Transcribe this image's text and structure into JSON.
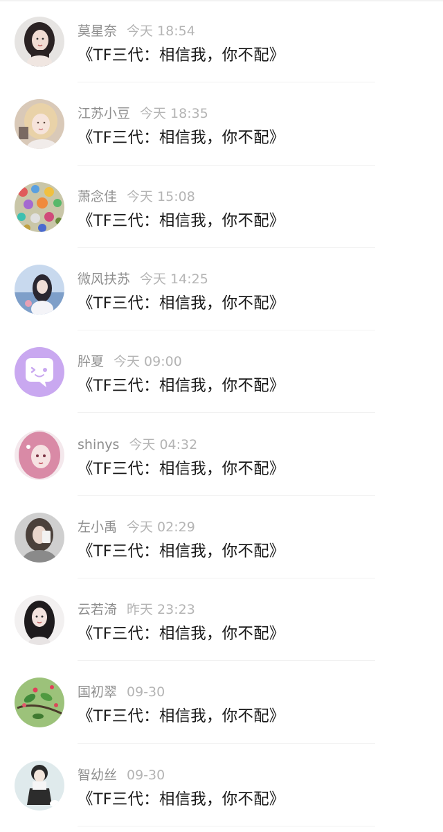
{
  "comments": [
    {
      "username": "莫星奈",
      "time": "今天 18:54",
      "text": "《TF三代：相信我，你不配》",
      "avatar_icon": "portrait-dark-hair-avatar"
    },
    {
      "username": "江苏小豆",
      "time": "今天 18:35",
      "text": "《TF三代：相信我，你不配》",
      "avatar_icon": "portrait-blonde-girl-avatar"
    },
    {
      "username": "萧念佳",
      "time": "今天 15:08",
      "text": "《TF三代：相信我，你不配》",
      "avatar_icon": "sticker-collage-avatar"
    },
    {
      "username": "微风扶苏",
      "time": "今天 14:25",
      "text": "《TF三代：相信我，你不配》",
      "avatar_icon": "portrait-sky-girl-avatar"
    },
    {
      "username": "肸夏",
      "time": "今天 09:00",
      "text": "《TF三代：相信我，你不配》",
      "avatar_icon": "purple-chat-bubble-avatar"
    },
    {
      "username": "shinys",
      "time": "今天 04:32",
      "text": "《TF三代：相信我，你不配》",
      "avatar_icon": "pink-hair-girl-avatar"
    },
    {
      "username": "左小禹",
      "time": "今天 02:29",
      "text": "《TF三代：相信我，你不配》",
      "avatar_icon": "mirror-selfie-avatar"
    },
    {
      "username": "云若渏",
      "time": "昨天 23:23",
      "text": "《TF三代：相信我，你不配》",
      "avatar_icon": "portrait-black-hair-girl-avatar"
    },
    {
      "username": "国初翠",
      "time": "09-30",
      "text": "《TF三代：相信我，你不配》",
      "avatar_icon": "green-plant-avatar"
    },
    {
      "username": "智幼丝",
      "time": "09-30",
      "text": "《TF三代：相信我，你不配》",
      "avatar_icon": "illustrated-boy-avatar"
    }
  ]
}
